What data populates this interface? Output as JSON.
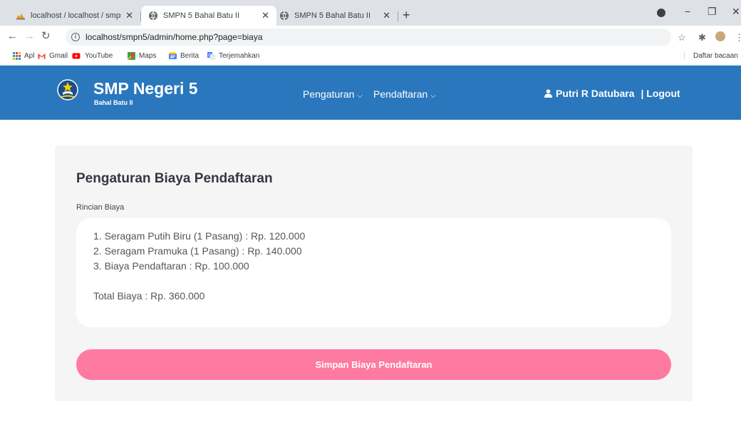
{
  "browser": {
    "tabs": [
      {
        "title": "localhost / localhost / smpn5 / s",
        "active": false,
        "icon": "phpmyadmin-icon"
      },
      {
        "title": "SMPN 5 Bahal Batu II",
        "active": true,
        "icon": "globe-icon"
      },
      {
        "title": "SMPN 5 Bahal Batu II",
        "active": false,
        "icon": "globe-icon"
      }
    ],
    "url": "localhost/smpn5/admin/home.php?page=biaya",
    "bookmarks": [
      {
        "label": "Apl",
        "icon": "apps-grid-icon"
      },
      {
        "label": "Gmail",
        "icon": "gmail-icon"
      },
      {
        "label": "YouTube",
        "icon": "youtube-icon"
      },
      {
        "label": "Maps",
        "icon": "maps-icon"
      },
      {
        "label": "Berita",
        "icon": "news-icon"
      },
      {
        "label": "Terjemahkan",
        "icon": "translate-icon"
      }
    ],
    "reading_list": "Daftar bacaan"
  },
  "header": {
    "title": "SMP Negeri 5",
    "subtitle": "Bahal Batu II",
    "nav": [
      {
        "label": "Pengaturan"
      },
      {
        "label": "Pendaftaran"
      }
    ],
    "user_name": "Putri R Datubara",
    "logout": "| Logout",
    "color": "#2a77bd"
  },
  "main": {
    "title": "Pengaturan Biaya Pendaftaran",
    "field_label": "Rincian Biaya",
    "fee_lines": [
      "1. Seragam Putih Biru (1 Pasang) : Rp. 120.000",
      "2. Seragam Pramuka (1 Pasang) : Rp. 140.000",
      "3. Biaya Pendaftaran : Rp. 100.000"
    ],
    "total": "Total Biaya : Rp. 360.000",
    "save_button": "Simpan Biaya Pendaftaran",
    "button_color": "#fe7aa1"
  }
}
